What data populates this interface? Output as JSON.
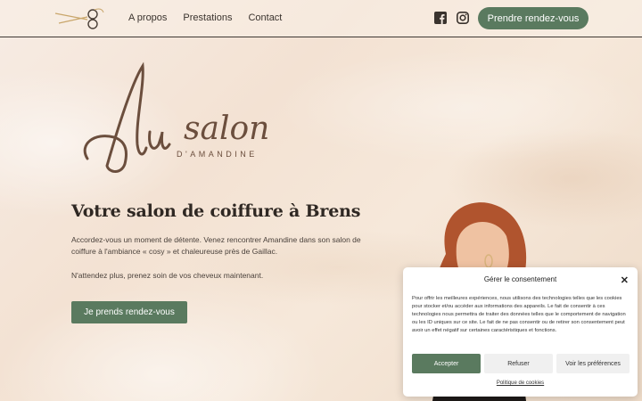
{
  "header": {
    "nav": [
      "A propos",
      "Prestations",
      "Contact"
    ],
    "cta_label": "Prendre rendez-vous"
  },
  "icons": {
    "logo": "scissors-icon",
    "facebook": "facebook-icon",
    "instagram": "instagram-icon",
    "close": "close-icon"
  },
  "hero": {
    "logo_script": "Au salon",
    "logo_sub": "D'AMANDINE",
    "title": "Votre salon de coiffure à Brens",
    "paragraph1": "Accordez-vous un moment de détente. Venez rencontrer Amandine dans son salon de coiffure à l'ambiance « cosy » et chaleureuse près de Gaillac.",
    "paragraph2": "N'attendez plus, prenez soin de vos cheveux maintenant.",
    "cta_label": "Je prends rendez-vous"
  },
  "consent": {
    "title": "Gérer le consentement",
    "body": "Pour offrir les meilleures expériences, nous utilisons des technologies telles que les cookies pour stocker et/ou accéder aux informations des appareils. Le fait de consentir à ces technologies nous permettra de traiter des données telles que le comportement de navigation ou les ID uniques sur ce site. Le fait de ne pas consentir ou de retirer son consentement peut avoir un effet négatif sur certaines caractéristiques et fonctions.",
    "accept_label": "Accepter",
    "refuse_label": "Refuser",
    "prefs_label": "Voir les préférences",
    "policy_link": "Politique de cookies"
  },
  "colors": {
    "accent": "#5a7a5f",
    "logo_brown": "#6b4e3d",
    "scissors_gold": "#c9a66b"
  }
}
